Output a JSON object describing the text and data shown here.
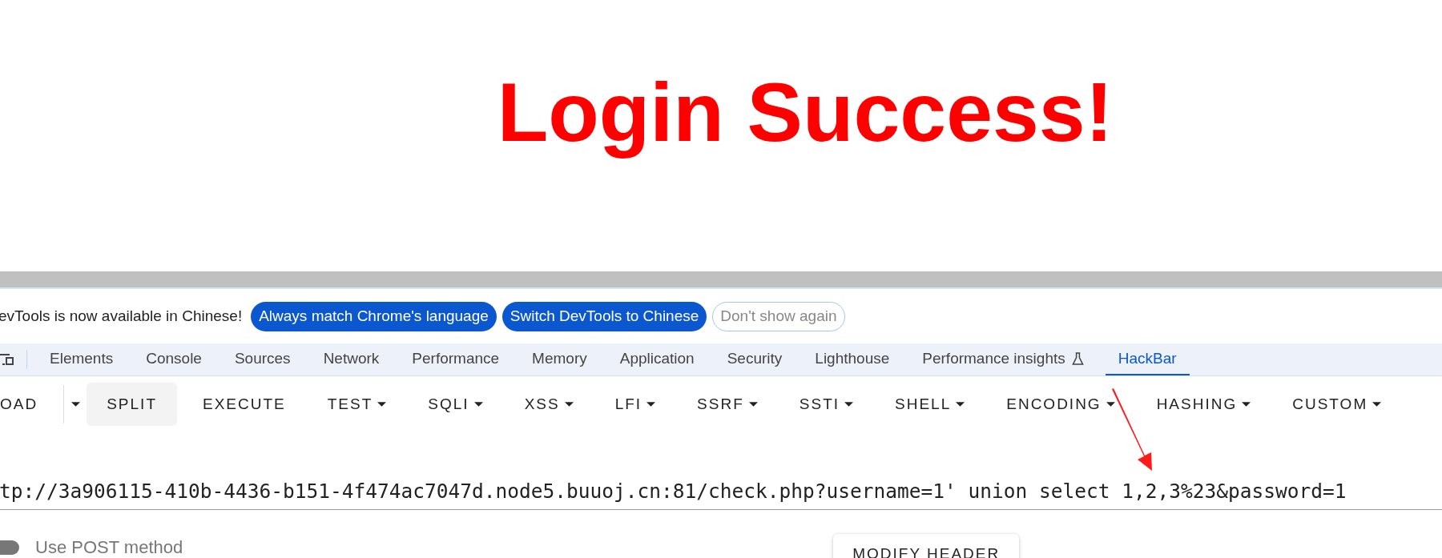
{
  "page": {
    "heading": "Login Success!"
  },
  "devtools": {
    "banner": {
      "message": "evTools is now available in Chinese!",
      "buttons": [
        {
          "label": "Always match Chrome's language",
          "kind": "primary"
        },
        {
          "label": "Switch DevTools to Chinese",
          "kind": "primary"
        },
        {
          "label": "Don't show again",
          "kind": "outline"
        }
      ]
    },
    "tabs": [
      {
        "label": "Elements",
        "selected": false,
        "experimental": false
      },
      {
        "label": "Console",
        "selected": false,
        "experimental": false
      },
      {
        "label": "Sources",
        "selected": false,
        "experimental": false
      },
      {
        "label": "Network",
        "selected": false,
        "experimental": false
      },
      {
        "label": "Performance",
        "selected": false,
        "experimental": false
      },
      {
        "label": "Memory",
        "selected": false,
        "experimental": false
      },
      {
        "label": "Application",
        "selected": false,
        "experimental": false
      },
      {
        "label": "Security",
        "selected": false,
        "experimental": false
      },
      {
        "label": "Lighthouse",
        "selected": false,
        "experimental": false
      },
      {
        "label": "Performance insights",
        "selected": false,
        "experimental": true
      },
      {
        "label": "HackBar",
        "selected": true,
        "experimental": false
      }
    ]
  },
  "hackbar": {
    "toolbar": [
      {
        "kind": "button",
        "label": "OAD",
        "dropdown": false,
        "highlighted": false
      },
      {
        "kind": "split-caret"
      },
      {
        "kind": "button",
        "label": "SPLIT",
        "dropdown": false,
        "highlighted": true
      },
      {
        "kind": "button",
        "label": "EXECUTE",
        "dropdown": false,
        "highlighted": false
      },
      {
        "kind": "button",
        "label": "TEST",
        "dropdown": true,
        "highlighted": false
      },
      {
        "kind": "button",
        "label": "SQLI",
        "dropdown": true,
        "highlighted": false
      },
      {
        "kind": "button",
        "label": "XSS",
        "dropdown": true,
        "highlighted": false
      },
      {
        "kind": "button",
        "label": "LFI",
        "dropdown": true,
        "highlighted": false
      },
      {
        "kind": "button",
        "label": "SSRF",
        "dropdown": true,
        "highlighted": false
      },
      {
        "kind": "button",
        "label": "SSTI",
        "dropdown": true,
        "highlighted": false
      },
      {
        "kind": "button",
        "label": "SHELL",
        "dropdown": true,
        "highlighted": false
      },
      {
        "kind": "button",
        "label": "ENCODING",
        "dropdown": true,
        "highlighted": false
      },
      {
        "kind": "button",
        "label": "HASHING",
        "dropdown": true,
        "highlighted": false
      },
      {
        "kind": "button",
        "label": "CUSTOM",
        "dropdown": true,
        "highlighted": false
      }
    ],
    "url": "tp://3a906115-410b-4436-b151-4f474ac7047d.node5.buuoj.cn:81/check.php?username=1' union select 1,2,3%23&password=1",
    "post_method": {
      "label": "Use POST method",
      "on": false
    },
    "modify_header": "MODIFY HEADER"
  }
}
